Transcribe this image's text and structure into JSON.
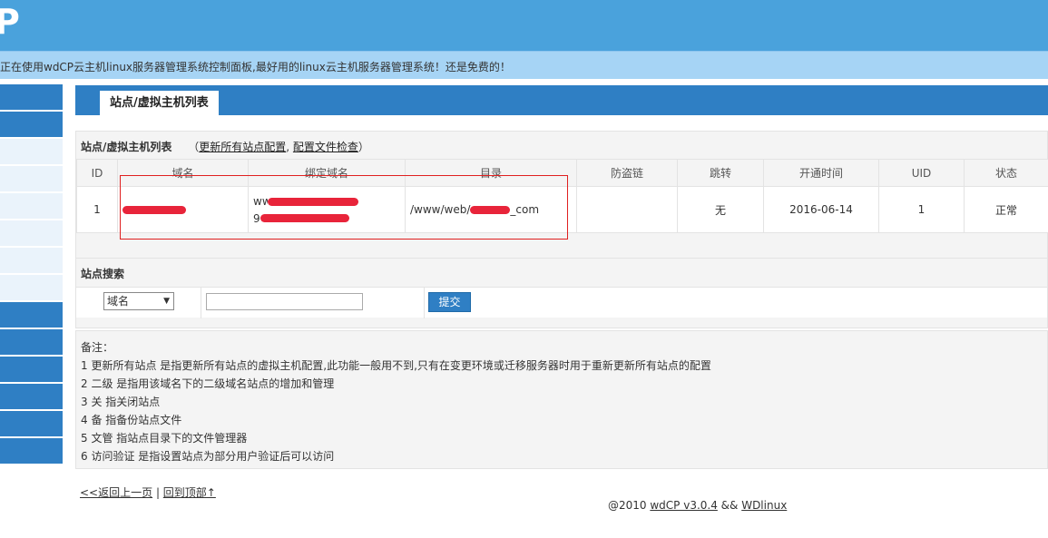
{
  "header": {
    "logo": "P"
  },
  "notice": "正在使用wdCP云主机linux服务器管理系统控制面板,最好用的linux云主机服务器管理系统！还是免费的！",
  "page_title": "站点/虚拟主机列表",
  "list": {
    "heading": "站点/虚拟主机列表",
    "paren_open": "（",
    "link_update": "更新所有站点配置",
    "sep": ",",
    "link_check": "配置文件检查",
    "paren_close": "）",
    "columns": [
      "ID",
      "域名",
      "绑定域名",
      "目录",
      "防盗链",
      "跳转",
      "开通时间",
      "UID",
      "状态"
    ],
    "rows": [
      {
        "id": "1",
        "domain": "9***.com",
        "bind1": "ww***",
        "bind2": "9***.com",
        "dir_prefix": "/www/web/",
        "dir_suffix": "_com",
        "antileech": "",
        "redirect": "无",
        "date": "2016-06-14",
        "uid": "1",
        "status": "正常"
      }
    ]
  },
  "search": {
    "title": "站点搜索",
    "field_selected": "域名",
    "input_value": "",
    "submit_label": "提交"
  },
  "notes": {
    "title": "备注：",
    "items": [
      "1 更新所有站点 是指更新所有站点的虚拟主机配置,此功能一般用不到,只有在变更环境或迁移服务器时用于重新更新所有站点的配置",
      "2 二级 是指用该域名下的二级域名站点的增加和管理",
      "3 关 指关闭站点",
      "4 备 指备份站点文件",
      "5 文管 指站点目录下的文件管理器",
      "6 访问验证 是指设置站点为部分用户验证后可以访问"
    ]
  },
  "nav": {
    "back_label": "<<返回上一页",
    "sep": " | ",
    "top_label": "回到顶部↑"
  },
  "footer": {
    "copyright": "@2010 ",
    "product_link": "wdCP v3.0.4",
    "and": " && ",
    "company_link": "WDlinux"
  },
  "colors": {
    "topbar": "#4aa2dc",
    "notice_bg": "#a6d4f5",
    "accent": "#2f7fc4",
    "annotation_box": "#e02020"
  }
}
